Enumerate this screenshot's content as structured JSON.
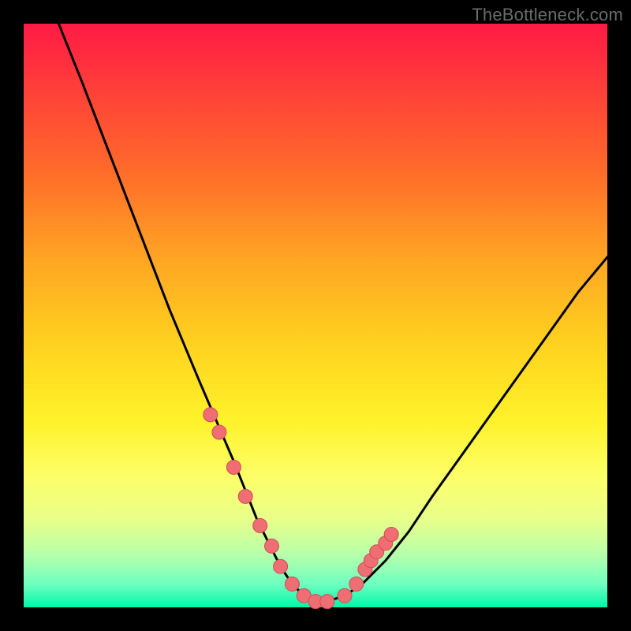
{
  "watermark": "TheBottleneck.com",
  "chart_data": {
    "type": "line",
    "title": "",
    "xlabel": "",
    "ylabel": "",
    "xlim": [
      0,
      100
    ],
    "ylim": [
      0,
      100
    ],
    "grid": false,
    "legend": false,
    "series": [
      {
        "name": "bottleneck-curve",
        "x": [
          6,
          10,
          15,
          20,
          25,
          30,
          33,
          36,
          38,
          40,
          42,
          44,
          46,
          48,
          50,
          52,
          55,
          58,
          62,
          66,
          70,
          75,
          80,
          85,
          90,
          95,
          100
        ],
        "values": [
          100,
          90,
          77,
          64,
          51,
          39,
          32,
          25,
          20,
          15,
          11,
          7,
          4,
          2,
          1,
          1,
          2,
          4,
          8,
          13,
          19,
          26,
          33,
          40,
          47,
          54,
          60
        ]
      },
      {
        "name": "dot-markers",
        "x": [
          32,
          33.5,
          36,
          38,
          40.5,
          42.5,
          44,
          46,
          48,
          50,
          52,
          55,
          57,
          58.5,
          59.5,
          60.5,
          62,
          63
        ],
        "values": [
          33,
          30,
          24,
          19,
          14,
          10.5,
          7,
          4,
          2,
          1,
          1,
          2,
          4,
          6.5,
          8,
          9.5,
          11,
          12.5
        ]
      }
    ],
    "colors": {
      "curve": "#000000",
      "dots_fill": "#ef6e74",
      "dots_stroke": "#d44a54",
      "background_top": "#ff1a44",
      "background_bottom": "#00f7a8"
    }
  }
}
